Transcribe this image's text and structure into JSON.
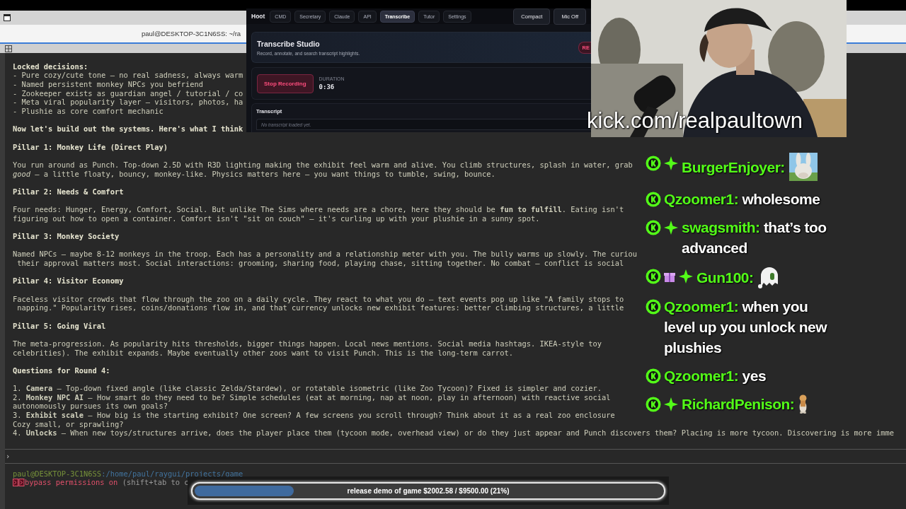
{
  "terminal": {
    "title": "paul@DESKTOP-3C1N6SS: ~/ra",
    "lines": [
      {
        "kind": "heading",
        "text": "Locked decisions:"
      },
      {
        "kind": "line",
        "text": "- Pure cozy/cute tone — no real sadness, always warm"
      },
      {
        "kind": "line",
        "text": "- Named persistent monkey NPCs you befriend"
      },
      {
        "kind": "line",
        "text": "- Zookeeper exists as guardian angel / tutorial / co"
      },
      {
        "kind": "line",
        "text": "- Meta viral popularity layer — visitors, photos, ha"
      },
      {
        "kind": "line",
        "text": "- Plushie as core comfort mechanic"
      },
      {
        "kind": "heading",
        "text": "Now let's build out the systems. Here's what I think"
      },
      {
        "kind": "heading",
        "text": "Pillar 1: Monkey Life (Direct Play)"
      },
      {
        "kind": "para",
        "text": "You run around as Punch. Top-down 2.5D with R3D lighting making the exhibit feel warm and alive. You climb structures, splash in water, grab"
      },
      {
        "kind": "line",
        "text": "*good* — a little floaty, bouncy, monkey-like. Physics matters here — you want things to tumble, swing, bounce."
      },
      {
        "kind": "heading",
        "text": "Pillar 2: Needs & Comfort"
      },
      {
        "kind": "para",
        "text": "Four needs: Hunger, Energy, Comfort, Social. But unlike The Sims where needs are a chore, here they should be **fun to fulfill**. Eating isn't"
      },
      {
        "kind": "line",
        "text": "figuring out how to open a container. Comfort isn't \"sit on couch\" — it's curling up with your plushie in a sunny spot."
      },
      {
        "kind": "heading",
        "text": "Pillar 3: Monkey Society"
      },
      {
        "kind": "para",
        "text": "Named NPCs — maybe 8-12 monkeys in the troop. Each has a personality and a relationship meter with you. The bully warms up slowly. The curiou"
      },
      {
        "kind": "line",
        "text": " their approval matters most. Social interactions: grooming, sharing food, playing chase, sitting together. No combat — conflict is social"
      },
      {
        "kind": "heading",
        "text": "Pillar 4: Visitor Economy"
      },
      {
        "kind": "para",
        "text": "Faceless visitor crowds that flow through the zoo on a daily cycle. They react to what you do — text events pop up like \"A family stops to"
      },
      {
        "kind": "line",
        "text": " napping.\" Popularity rises, coins/donations flow in, and that currency unlocks new exhibit features: better climbing structures, a little"
      },
      {
        "kind": "heading",
        "text": "Pillar 5: Going Viral"
      },
      {
        "kind": "para",
        "text": "The meta-progression. As popularity hits thresholds, bigger things happen. Local news mentions. Social media hashtags. IKEA-style toy"
      },
      {
        "kind": "line",
        "text": "celebrities). The exhibit expands. Maybe eventually other zoos want to visit Punch. This is the long-term carrot."
      },
      {
        "kind": "heading",
        "text": "Questions for Round 4:"
      },
      {
        "kind": "para",
        "text": "1. **Camera** — Top-down fixed angle (like classic Zelda/Stardew), or rotatable isometric (like Zoo Tycoon)? Fixed is simpler and cozier."
      },
      {
        "kind": "line",
        "text": "2. **Monkey NPC AI** — How smart do they need to be? Simple schedules (eat at morning, nap at noon, play in afternoon) with reactive social"
      },
      {
        "kind": "line",
        "text": "autonomously pursues its own goals?"
      },
      {
        "kind": "line",
        "text": "3. **Exhibit scale** — How big is the starting exhibit? One screen? A few screens you scroll through? Think about it as a real zoo enclosure"
      },
      {
        "kind": "line",
        "text": "Cozy small, or sprawling?"
      },
      {
        "kind": "line",
        "text": "4. **Unlocks** — When new toys/structures arrive, does the player place them (tycoon mode, overhead view) or do they just appear and Punch discovers them? Placing is more tycoon. Discovering is more imme"
      }
    ],
    "prompt": "›",
    "path": {
      "user": "paul@DESKTOP-3C1N6SS",
      "dir": ":/home/paul/raygui/projects/game"
    },
    "mode": {
      "label": "bypass permissions on",
      "hint": "(shift+tab to c"
    }
  },
  "hoot": {
    "brand": "Hoot",
    "tabs": [
      {
        "label": "CMD",
        "selected": false
      },
      {
        "label": "Secretary",
        "selected": false
      },
      {
        "label": "Claude",
        "selected": false
      },
      {
        "label": "API",
        "selected": false
      },
      {
        "label": "Transcribe",
        "selected": true
      },
      {
        "label": "Tutor",
        "selected": false
      },
      {
        "label": "Settings",
        "selected": false
      }
    ],
    "buttons": [
      "Compact",
      "Mic Off"
    ],
    "header": {
      "title": "Transcribe Studio",
      "subtitle": "Record, annotate, and search transcript highlights.",
      "badge": "RE"
    },
    "recording": {
      "button": "Stop Recording",
      "duration_label": "DURATION",
      "duration": "0:36"
    },
    "transcript": {
      "title": "Transcript",
      "placeholder": "No transcript loaded yet."
    }
  },
  "webcam": {
    "kind": "picture",
    "caption": "kick.com/realpaultown"
  },
  "chat": [
    {
      "user": "BurgerEnjoyer:",
      "badges": [
        {
          "kind": "kick"
        },
        {
          "kind": "sub"
        }
      ],
      "emote": {
        "kind": "picture"
      }
    },
    {
      "user": "Qzoomer1:",
      "badges": [
        {
          "kind": "kick"
        }
      ],
      "text": "wholesome"
    },
    {
      "user": "swagsmith:",
      "badges": [
        {
          "kind": "kick"
        },
        {
          "kind": "sub"
        }
      ],
      "text": "that’s too advanced"
    },
    {
      "user": "Gun100:",
      "badges": [
        {
          "kind": "kick"
        },
        {
          "kind": "gift"
        },
        {
          "kind": "sub"
        }
      ],
      "emote": {
        "kind": "ghost"
      }
    },
    {
      "user": "Qzoomer1:",
      "badges": [
        {
          "kind": "kick"
        }
      ],
      "text": "when you level up you unlock new plushies"
    },
    {
      "user": "Qzoomer1:",
      "badges": [
        {
          "kind": "kick"
        }
      ],
      "text": "yes"
    },
    {
      "user": "RichardPenison:",
      "badges": [
        {
          "kind": "kick"
        },
        {
          "kind": "sub"
        }
      ],
      "emote": {
        "kind": "figure"
      }
    }
  ],
  "goal": {
    "text": "release demo of game $2002.58 / $9500.00 (21%)",
    "level": 0.21
  }
}
